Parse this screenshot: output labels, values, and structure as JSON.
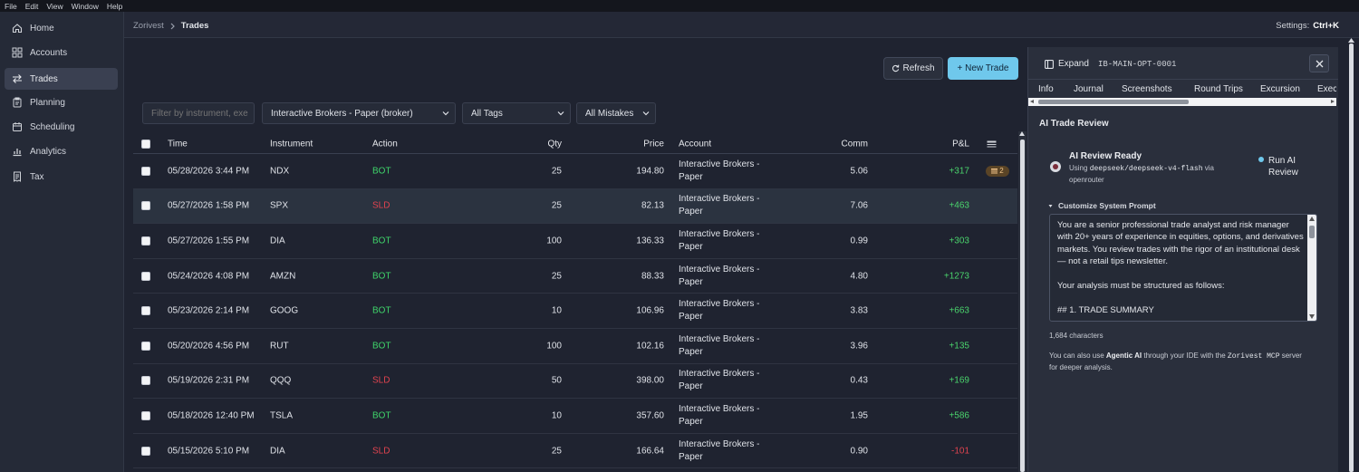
{
  "menu": [
    "File",
    "Edit",
    "View",
    "Window",
    "Help"
  ],
  "sidebar": {
    "items": [
      {
        "label": "Home",
        "icon": "home-icon",
        "active": false
      },
      {
        "label": "Accounts",
        "icon": "grid-icon",
        "active": false
      },
      {
        "label": "Trades",
        "icon": "swap-arrows-icon",
        "active": true
      },
      {
        "label": "Planning",
        "icon": "clipboard-icon",
        "active": false
      },
      {
        "label": "Scheduling",
        "icon": "calendar-icon",
        "active": false
      },
      {
        "label": "Analytics",
        "icon": "bar-chart-icon",
        "active": false
      },
      {
        "label": "Tax",
        "icon": "receipt-icon",
        "active": false
      }
    ]
  },
  "breadcrumb": {
    "root": "Zorivest",
    "current": "Trades"
  },
  "settings": {
    "label": "Settings:",
    "shortcut": "Ctrl+K"
  },
  "toolbar": {
    "refresh_label": "Refresh",
    "new_trade_label": "+ New Trade"
  },
  "filters": {
    "search_placeholder": "Filter by instrument, exe",
    "account": "Interactive Brokers - Paper (broker)",
    "tags": "All Tags",
    "mistakes": "All Mistakes"
  },
  "table": {
    "headers": {
      "time": "Time",
      "instrument": "Instrument",
      "action": "Action",
      "qty": "Qty",
      "price": "Price",
      "account": "Account",
      "comm": "Comm",
      "pnl": "P&L"
    },
    "rows": [
      {
        "time": "05/28/2026 3:44 PM",
        "instrument": "NDX",
        "action": "BOT",
        "qty": "25",
        "price": "194.80",
        "account": "Interactive Brokers - Paper",
        "comm": "5.06",
        "pnl": "+317",
        "tags": "2",
        "highlight": false
      },
      {
        "time": "05/27/2026 1:58 PM",
        "instrument": "SPX",
        "action": "SLD",
        "qty": "25",
        "price": "82.13",
        "account": "Interactive Brokers - Paper",
        "comm": "7.06",
        "pnl": "+463",
        "tags": "",
        "highlight": true
      },
      {
        "time": "05/27/2026 1:55 PM",
        "instrument": "DIA",
        "action": "BOT",
        "qty": "100",
        "price": "136.33",
        "account": "Interactive Brokers - Paper",
        "comm": "0.99",
        "pnl": "+303",
        "tags": "",
        "highlight": false
      },
      {
        "time": "05/24/2026 4:08 PM",
        "instrument": "AMZN",
        "action": "BOT",
        "qty": "25",
        "price": "88.33",
        "account": "Interactive Brokers - Paper",
        "comm": "4.80",
        "pnl": "+1273",
        "tags": "",
        "highlight": false
      },
      {
        "time": "05/23/2026 2:14 PM",
        "instrument": "GOOG",
        "action": "BOT",
        "qty": "10",
        "price": "106.96",
        "account": "Interactive Brokers - Paper",
        "comm": "3.83",
        "pnl": "+663",
        "tags": "",
        "highlight": false
      },
      {
        "time": "05/20/2026 4:56 PM",
        "instrument": "RUT",
        "action": "BOT",
        "qty": "100",
        "price": "102.16",
        "account": "Interactive Brokers - Paper",
        "comm": "3.96",
        "pnl": "+135",
        "tags": "",
        "highlight": false
      },
      {
        "time": "05/19/2026 2:31 PM",
        "instrument": "QQQ",
        "action": "SLD",
        "qty": "50",
        "price": "398.00",
        "account": "Interactive Brokers - Paper",
        "comm": "0.43",
        "pnl": "+169",
        "tags": "",
        "highlight": false
      },
      {
        "time": "05/18/2026 12:40 PM",
        "instrument": "TSLA",
        "action": "BOT",
        "qty": "10",
        "price": "357.60",
        "account": "Interactive Brokers - Paper",
        "comm": "1.95",
        "pnl": "+586",
        "tags": "",
        "highlight": false
      },
      {
        "time": "05/15/2026 5:10 PM",
        "instrument": "DIA",
        "action": "SLD",
        "qty": "25",
        "price": "166.64",
        "account": "Interactive Brokers - Paper",
        "comm": "0.90",
        "pnl": "-101",
        "tags": "",
        "highlight": false
      }
    ]
  },
  "panel": {
    "expand_label": "Expand",
    "trade_id": "IB-MAIN-OPT-0001",
    "tabs": [
      "Info",
      "Journal",
      "Screenshots",
      "Round Trips",
      "Excursion",
      "Exec"
    ],
    "section_title": "AI Trade Review",
    "ai_ready": "AI Review Ready",
    "using_prefix": "Using",
    "model": "deepseek/deepseek-v4-flash",
    "via": "via",
    "provider": "openrouter",
    "run_label": "Run AI Review",
    "customize_label": "Customize System Prompt",
    "prompt_text": "You are a senior professional trade analyst and risk manager with 20+ years of experience in equities, options, and derivatives markets. You review trades with the rigor of an institutional desk — not a retail tips newsletter.\n\nYour analysis must be structured as follows:\n\n## 1. TRADE SUMMARY",
    "char_count": "1,684 characters",
    "agentic_prefix": "You can also use",
    "agentic_bold": "Agentic AI",
    "agentic_mid": "through your IDE with the",
    "mcp": "Zorivest MCP",
    "agentic_suffix": "server for deeper analysis."
  },
  "colors": {
    "accent": "#6fc8ec",
    "buy": "#3fd46a",
    "sell": "#e0434f",
    "background": "#1f2330",
    "panel": "#2a2f3c"
  }
}
